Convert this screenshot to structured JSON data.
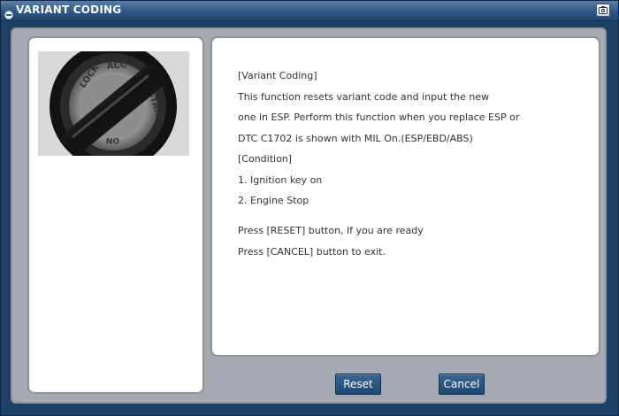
{
  "window": {
    "title": "VARIANT CODING",
    "title_icon": "dialog-icon",
    "capture_icon": "camera-icon"
  },
  "image": {
    "description_icon": "ignition-key-icon",
    "key_labels": [
      "LOCK",
      "ACC",
      "START",
      "ON"
    ]
  },
  "message": {
    "lines": [
      "[Variant Coding]",
      "This function resets variant code and input the new",
      "one in ESP. Perform this function when you replace ESP or",
      "DTC C1702 is shown with MIL On.(ESP/EBD/ABS)",
      "[Condition]",
      "1. Ignition key on",
      "2. Engine Stop",
      "Press [RESET] button, if you are ready",
      "Press [CANCEL] button to exit."
    ]
  },
  "buttons": {
    "reset_label": "Reset",
    "cancel_label": "Cancel"
  },
  "colors": {
    "titlebar": "#2f5785",
    "frame": "#1e3f66",
    "content_bg": "#a5a9b0",
    "button": "#2a5583"
  }
}
